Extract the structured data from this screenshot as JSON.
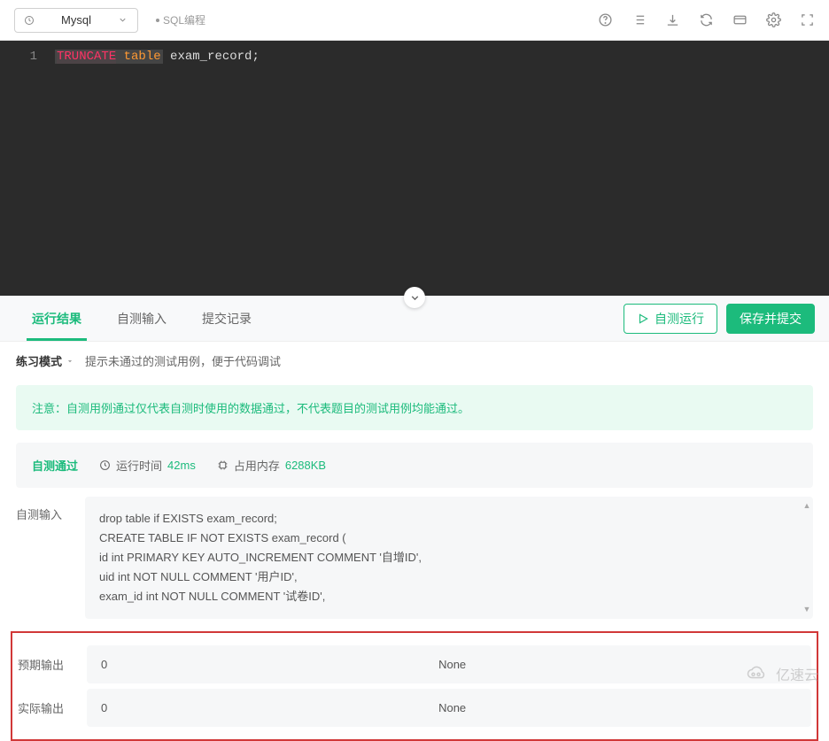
{
  "toolbar": {
    "db_name": "Mysql",
    "sql_label": "SQL编程"
  },
  "editor": {
    "line_number": "1",
    "kw_truncate": "TRUNCATE",
    "kw_table": "table",
    "rest": "exam_record;"
  },
  "tabs": {
    "items": [
      {
        "label": "运行结果"
      },
      {
        "label": "自测输入"
      },
      {
        "label": "提交记录"
      }
    ],
    "run_self_label": "自测运行",
    "save_submit_label": "保存并提交"
  },
  "mode": {
    "label": "练习模式",
    "hint": "提示未通过的测试用例，便于代码调试"
  },
  "notice": {
    "text": "注意：自测用例通过仅代表自测时使用的数据通过，不代表题目的测试用例均能通过。"
  },
  "status": {
    "pass_label": "自测通过",
    "runtime_label": "运行时间",
    "runtime_val": "42ms",
    "memory_label": "占用内存",
    "memory_val": "6288KB"
  },
  "self_input": {
    "label": "自测输入",
    "lines": [
      "drop table if EXISTS exam_record;",
      "CREATE TABLE IF NOT EXISTS exam_record (",
      "id int PRIMARY KEY AUTO_INCREMENT COMMENT '自增ID',",
      "uid int NOT NULL COMMENT '用户ID',",
      "exam_id int NOT NULL COMMENT '试卷ID',"
    ]
  },
  "outputs": {
    "expected_label": "预期输出",
    "actual_label": "实际输出",
    "zero": "0",
    "none": "None"
  },
  "watermark": "亿速云"
}
